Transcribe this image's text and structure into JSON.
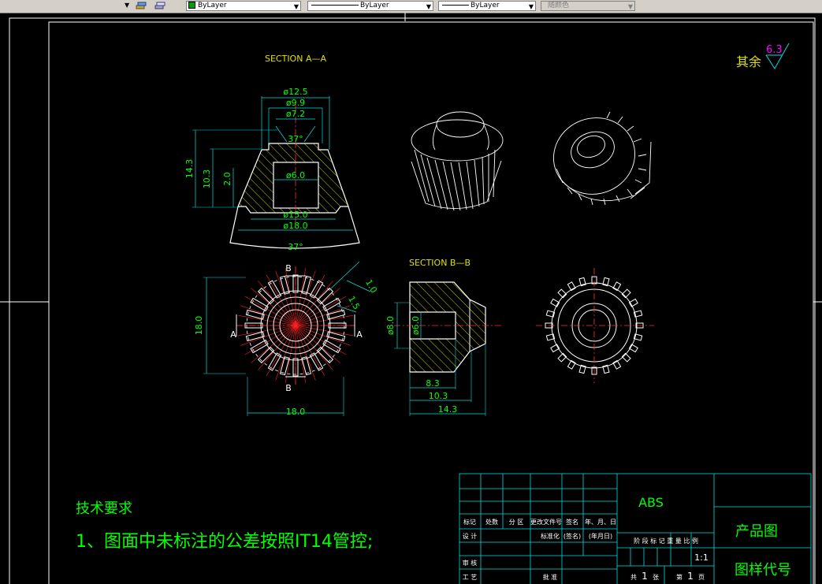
{
  "toolbar": {
    "combos": [
      {
        "kind": "color",
        "value": "ByLayer"
      },
      {
        "kind": "linetype",
        "value": "ByLayer"
      },
      {
        "kind": "lineweight",
        "value": "ByLayer"
      },
      {
        "kind": "plotstyle",
        "value": "随颜色"
      }
    ]
  },
  "drawing": {
    "section_aa": "SECTION A—A",
    "section_bb": "SECTION B—B",
    "surface_note": {
      "label": "其余",
      "value": "6.3"
    },
    "dims_aa": {
      "d1": "ø12.5",
      "d2": "ø9.9",
      "d3": "ø7.2",
      "angle_top": "37°",
      "bore": "ø6.0",
      "d4": "ø15.0",
      "d5": "ø18.0",
      "angle_bottom": "37°",
      "h1": "14.3",
      "h2": "10.3",
      "h3": "2.0"
    },
    "dims_front": {
      "height": "18.0",
      "width": "18.0",
      "r1": "1.0",
      "r2": "1.5",
      "mark_b_top": "B",
      "mark_b_bottom": "B",
      "mark_a_left": "A",
      "mark_a_right": "A"
    },
    "dims_bb": {
      "d8": "ø8.0",
      "d6": "ø6.0",
      "l1": "8.3",
      "l2": "10.3",
      "l3": "14.3"
    },
    "tech_title": "技术要求",
    "tech_item": "1、图面中未标注的公差按照IT14管控;"
  },
  "title_block": {
    "material": "ABS",
    "product_name": "产品图",
    "drawing_no_label": "图样代号",
    "scale_value": "1:1",
    "header_cells": [
      "标记",
      "处数",
      "分 区",
      "更改文件号",
      "签名",
      "年、月、日"
    ],
    "row_design": "设 计",
    "row_std": "标准化",
    "row_sign": "(签名)",
    "row_date": "(年月日)",
    "stage_labels": "阶 段 标 记   重 量   比 例",
    "row_review": "审 核",
    "row_process": "工 艺",
    "row_approve": "批 准",
    "sheets": {
      "total_prefix": "共",
      "total": "1",
      "total_unit": "张",
      "cur_prefix": "第",
      "cur": "1",
      "cur_unit": "页"
    }
  }
}
